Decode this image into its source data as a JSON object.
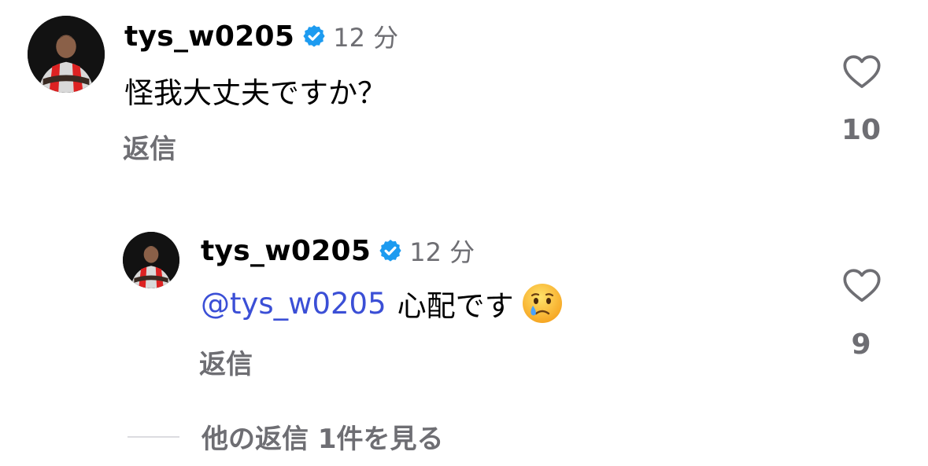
{
  "comments": [
    {
      "username": "tys_w0205",
      "verified": true,
      "time": "12 分",
      "text": "怪我大丈夫ですか？",
      "reply_label": "返信",
      "like_count": "10"
    },
    {
      "username": "tys_w0205",
      "verified": true,
      "time": "12 分",
      "mention": "@tys_w0205",
      "text": "心配です",
      "emoji": "crying-face",
      "reply_label": "返信",
      "like_count": "9"
    }
  ],
  "view_more": "他の返信 1件を見る",
  "colors": {
    "verified": "#1d9bf0",
    "mention": "#3b4fd6",
    "secondary": "#6e6e73"
  },
  "icons": {
    "verified": "verified-badge-icon",
    "like": "heart-outline-icon"
  }
}
